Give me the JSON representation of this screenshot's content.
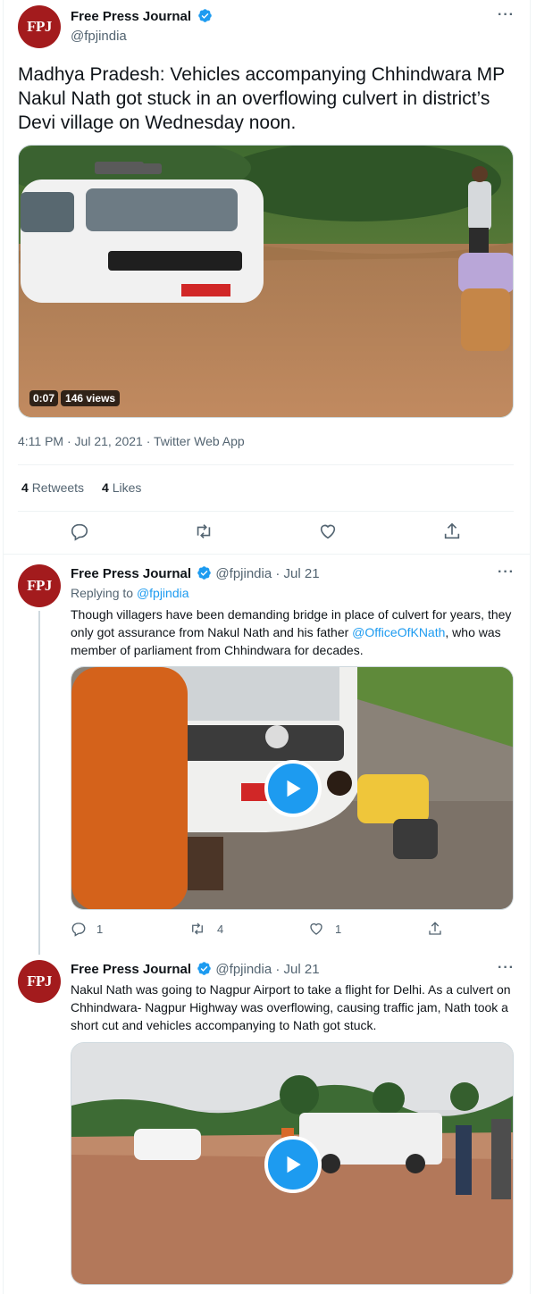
{
  "colors": {
    "accent": "#1d9bf0",
    "brand": "#a31b1d",
    "muted": "#536471"
  },
  "main_tweet": {
    "avatar_text": "FPJ",
    "name": "Free Press Journal",
    "handle": "@fpjindia",
    "more": "···",
    "text": "Madhya Pradesh: Vehicles accompanying Chhindwara MP Nakul Nath got stuck in an overflowing culvert in district’s Devi village on Wednesday noon.",
    "video_time": "0:07",
    "video_views": "146 views",
    "timestamp": "4:11 PM · Jul 21, 2021 · Twitter Web App",
    "retweets_count": "4",
    "retweets_label": "Retweets",
    "likes_count": "4",
    "likes_label": "Likes"
  },
  "reply1": {
    "avatar_text": "FPJ",
    "name": "Free Press Journal",
    "handle_time": "@fpjindia · Jul 21",
    "more": "···",
    "replying_prefix": "Replying to ",
    "replying_handle": "@fpjindia",
    "text_before": "Though villagers have been demanding bridge in place of culvert for years, they only got assurance from Nakul Nath and his father ",
    "mention": "@OfficeOfKNath",
    "text_after": ", who was member of parliament from Chhindwara for decades.",
    "reply_count": "1",
    "retweet_count": "4",
    "like_count": "1"
  },
  "reply2": {
    "avatar_text": "FPJ",
    "name": "Free Press Journal",
    "handle_time": "@fpjindia · Jul 21",
    "more": "···",
    "text": "Nakul Nath was going to Nagpur Airport to take a flight for Delhi. As a culvert on Chhindwara- Nagpur Highway was overflowing, causing traffic jam, Nath took a short cut and vehicles accompanying to Nath got stuck."
  }
}
